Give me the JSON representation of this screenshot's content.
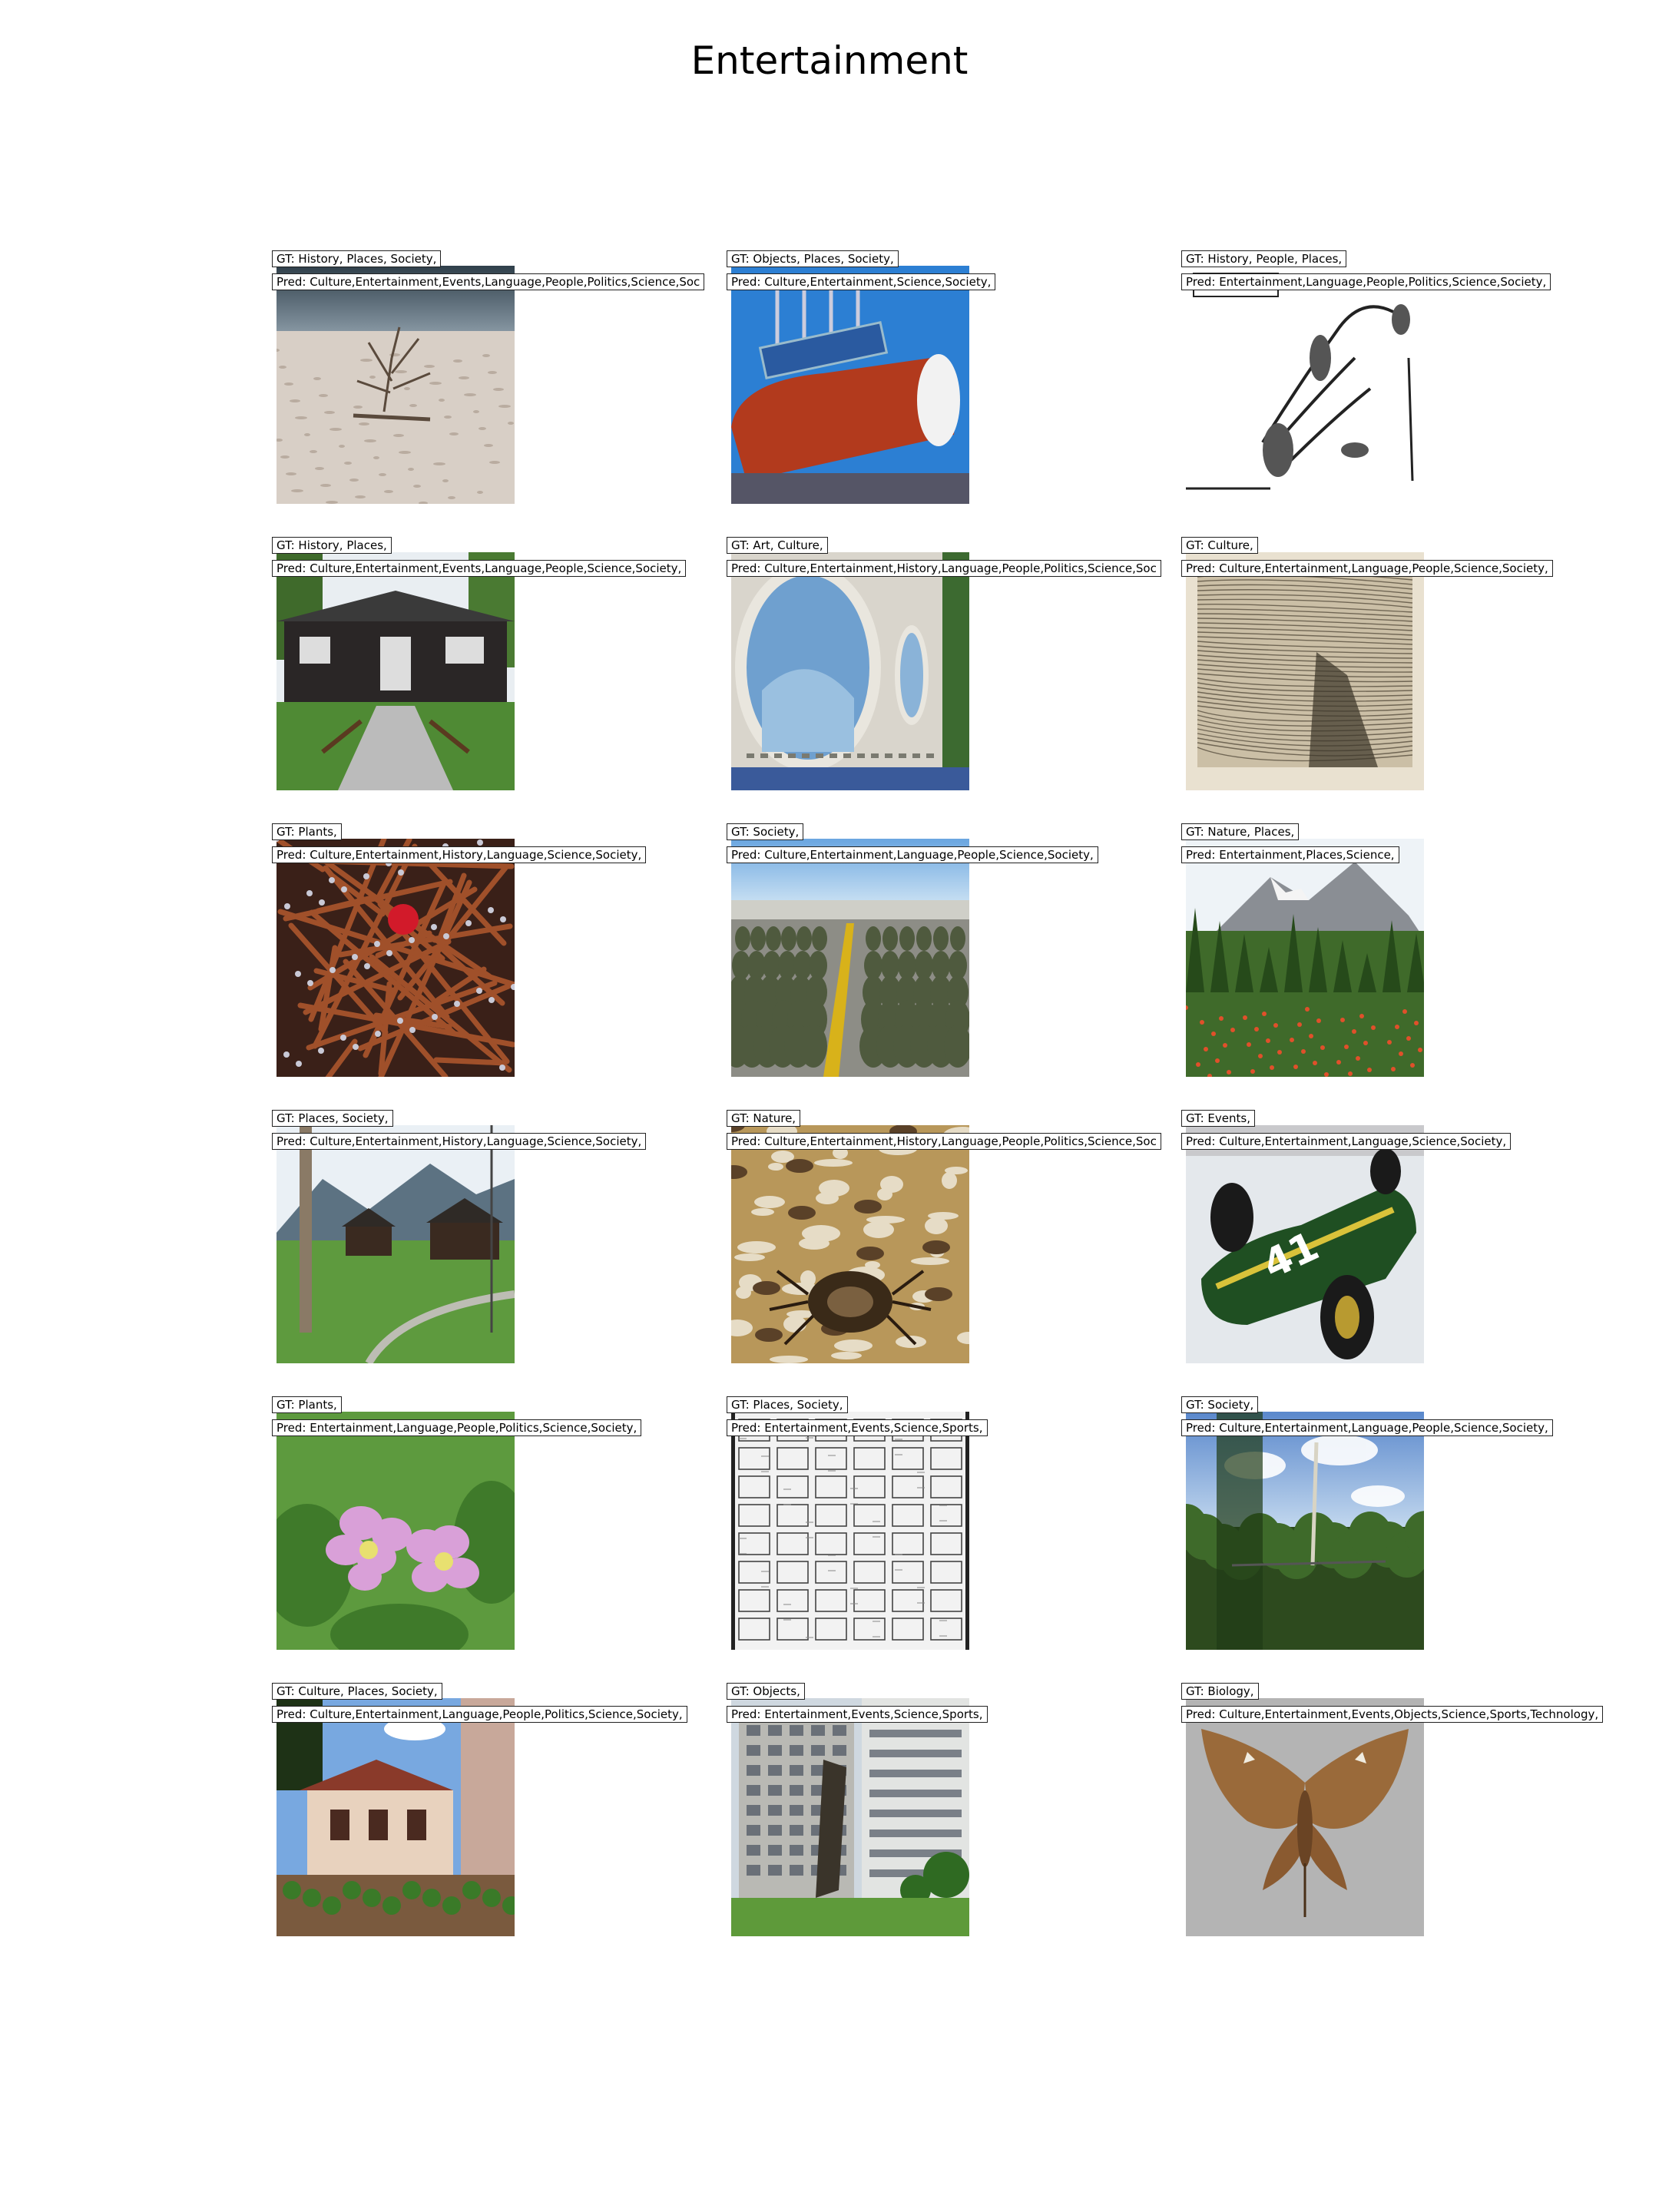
{
  "title": "Entertainment",
  "rows": [
    [
      {
        "gt": "GT: History, Places, Society,",
        "pred": "Pred: Culture,Entertainment,Events,Language,People,Politics,Science,Soc",
        "scene": "dead-tree-salt-flat"
      },
      {
        "gt": "GT: Objects, Places, Society,",
        "pred": "Pred: Culture,Entertainment,Science,Society,",
        "scene": "red-tank-sign"
      },
      {
        "gt": "GT: History, People, Places,",
        "pred": "Pred: Entertainment,Language,People,Politics,Science,Society,",
        "scene": "battle-map"
      }
    ],
    [
      {
        "gt": "GT: History, Places,",
        "pred": "Pred: Culture,Entertainment,Events,Language,People,Science,Society,",
        "scene": "wooden-hall"
      },
      {
        "gt": "GT: Art, Culture,",
        "pred": "Pred: Culture,Entertainment,History,Language,People,Politics,Science,Soc",
        "scene": "mural-wall"
      },
      {
        "gt": "GT: Culture,",
        "pred": "Pred: Culture,Entertainment,Language,People,Science,Society,",
        "scene": "etching"
      }
    ],
    [
      {
        "gt": "GT: Plants,",
        "pred": "Pred: Culture,Entertainment,History,Language,Science,Society,",
        "scene": "red-twigs"
      },
      {
        "gt": "GT: Society,",
        "pred": "Pred: Culture,Entertainment,Language,People,Science,Society,",
        "scene": "soldiers-runway"
      },
      {
        "gt": "GT: Nature, Places,",
        "pred": "Pred: Entertainment,Places,Science,",
        "scene": "mountain-meadow"
      }
    ],
    [
      {
        "gt": "GT: Places, Society,",
        "pred": "Pred: Culture,Entertainment,History,Language,Science,Society,",
        "scene": "alpine-village"
      },
      {
        "gt": "GT: Nature,",
        "pred": "Pred: Culture,Entertainment,History,Language,People,Politics,Science,Soc",
        "scene": "spider"
      },
      {
        "gt": "GT: Events,",
        "pred": "Pred: Culture,Entertainment,Language,Science,Society,",
        "scene": "race-car"
      }
    ],
    [
      {
        "gt": "GT: Plants,",
        "pred": "Pred: Entertainment,Language,People,Politics,Science,Society,",
        "scene": "pink-flowers"
      },
      {
        "gt": "GT: Places, Society,",
        "pred": "Pred: Entertainment,Events,Science,Sports,",
        "scene": "city-plan"
      },
      {
        "gt": "GT: Society,",
        "pred": "Pred: Culture,Entertainment,Language,People,Science,Society,",
        "scene": "forest-canopy"
      }
    ],
    [
      {
        "gt": "GT: Culture, Places, Society,",
        "pred": "Pred: Culture,Entertainment,Language,People,Politics,Science,Society,",
        "scene": "colonial-house"
      },
      {
        "gt": "GT: Objects,",
        "pred": "Pred: Entertainment,Events,Science,Sports,",
        "scene": "office-sculpture"
      },
      {
        "gt": "GT: Biology,",
        "pred": "Pred: Culture,Entertainment,Events,Objects,Science,Sports,Technology,",
        "scene": "moth"
      }
    ]
  ]
}
